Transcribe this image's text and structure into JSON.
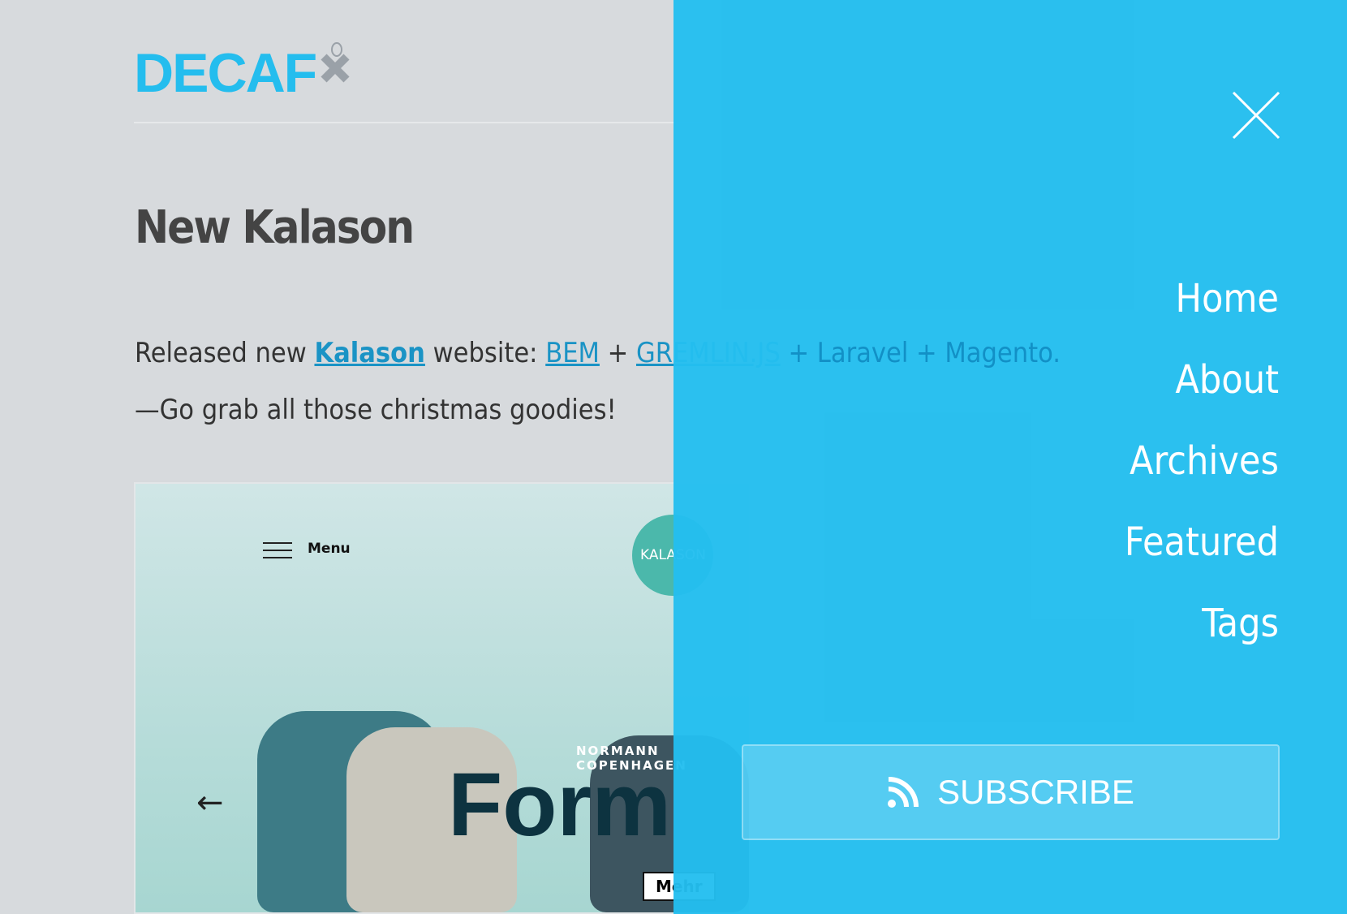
{
  "logo": {
    "text": "DECAF",
    "brand_color": "#24bdee"
  },
  "post": {
    "title": "New Kalason",
    "para_prefix": "Released new ",
    "link_kalason": "Kalason",
    "mid": " website: ",
    "link_bem": "BEM",
    "plus1": " + ",
    "link_gremlin": "GREMLIN.JS",
    "rest": " + Laravel + Magento.",
    "line2": "—Go grab all those christmas goodies!"
  },
  "screenshot": {
    "menu_label": "Menu",
    "badge": "KALASON",
    "brand": "NORMANN COPENHAGEN",
    "headline": "Form",
    "arrow": "←",
    "more": "Mehr"
  },
  "panel": {
    "color": "#23beef",
    "nav": [
      "Home",
      "About",
      "Archives",
      "Featured",
      "Tags"
    ],
    "subscribe": "SUBSCRIBE"
  }
}
